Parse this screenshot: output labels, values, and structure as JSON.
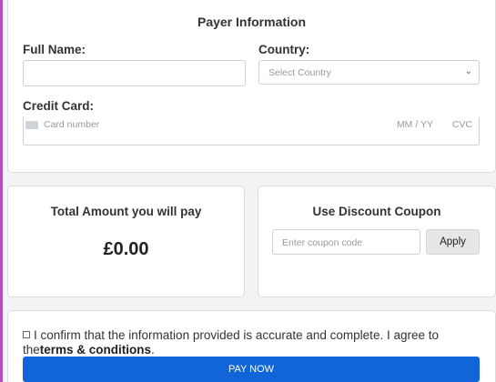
{
  "payer": {
    "title": "Payer Information",
    "full_name_label": "Full Name:",
    "full_name_value": "",
    "country_label": "Country:",
    "country_placeholder": "Select Country",
    "credit_card_label": "Credit Card:",
    "card_number_placeholder": "Card number",
    "expiry_placeholder": "MM / YY",
    "cvc_placeholder": "CVC"
  },
  "total": {
    "title": "Total Amount you will pay",
    "amount": "£0.00"
  },
  "coupon": {
    "title": "Use Discount Coupon",
    "placeholder": "Enter coupon code",
    "apply_label": "Apply"
  },
  "confirm": {
    "text": "I confirm that the information provided is accurate and complete. I agree to the",
    "terms_link": "terms & conditions",
    "after_link": ".",
    "pay_label": "PAY NOW"
  },
  "colors": {
    "accent": "#1165d8",
    "left_bar": "#b04fb8"
  }
}
